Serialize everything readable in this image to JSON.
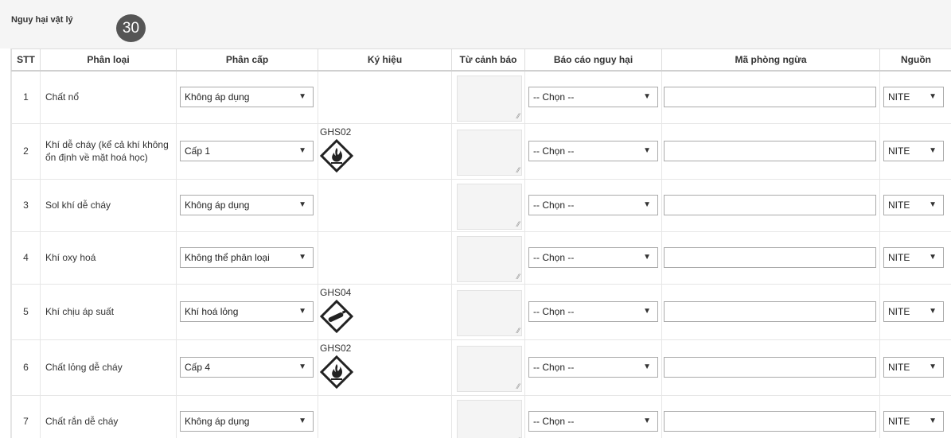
{
  "panel": {
    "title": "Nguy hại vật lý",
    "badge": "30"
  },
  "columns": {
    "stt": "STT",
    "classification": "Phân loại",
    "category": "Phân cấp",
    "symbol": "Ký hiệu",
    "warning": "Từ cảnh báo",
    "hazard_report": "Báo cáo nguy hại",
    "precaution": "Mã phòng ngừa",
    "source": "Nguồn"
  },
  "rows": [
    {
      "stt": "1",
      "name": "Chất nổ",
      "category": "Không áp dụng",
      "ghs": "",
      "ghs_icon": "",
      "report": "-- Chọn --",
      "precaution": "",
      "source": "NITE"
    },
    {
      "stt": "2",
      "name": "Khí dễ cháy (kể cả khí không ổn định về mặt hoá học)",
      "category": "Cấp 1",
      "ghs": "GHS02",
      "ghs_icon": "flame-icon",
      "report": "-- Chọn --",
      "precaution": "",
      "source": "NITE"
    },
    {
      "stt": "3",
      "name": "Sol khí dễ cháy",
      "category": "Không áp dụng",
      "ghs": "",
      "ghs_icon": "",
      "report": "-- Chọn --",
      "precaution": "",
      "source": "NITE"
    },
    {
      "stt": "4",
      "name": "Khí oxy hoá",
      "category": "Không thể phân loại",
      "ghs": "",
      "ghs_icon": "",
      "report": "-- Chọn --",
      "precaution": "",
      "source": "NITE"
    },
    {
      "stt": "5",
      "name": "Khí chịu áp suất",
      "category": "Khí hoá lỏng",
      "ghs": "GHS04",
      "ghs_icon": "gas-cylinder-icon",
      "report": "-- Chọn --",
      "precaution": "",
      "source": "NITE"
    },
    {
      "stt": "6",
      "name": "Chất lỏng dễ cháy",
      "category": "Cấp 4",
      "ghs": "GHS02",
      "ghs_icon": "flame-icon",
      "report": "-- Chọn --",
      "precaution": "",
      "source": "NITE"
    },
    {
      "stt": "7",
      "name": "Chất rắn dễ cháy",
      "category": "Không áp dụng",
      "ghs": "",
      "ghs_icon": "",
      "report": "-- Chọn --",
      "precaution": "",
      "source": "NITE"
    }
  ],
  "icons": {
    "dropdown": "caret-down-icon",
    "resize": "resize-grip-icon"
  }
}
